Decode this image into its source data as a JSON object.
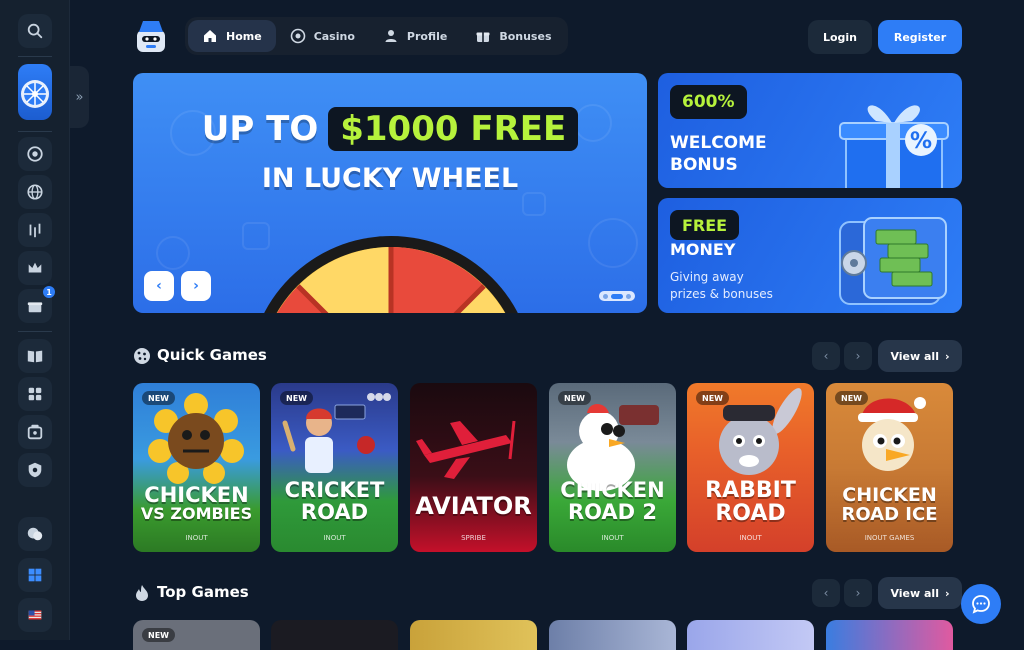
{
  "nav": {
    "items": [
      {
        "label": "Home",
        "icon": "home-icon",
        "active": true
      },
      {
        "label": "Casino",
        "icon": "casino-chip-icon",
        "active": false
      },
      {
        "label": "Profile",
        "icon": "user-icon",
        "active": false
      },
      {
        "label": "Bonuses",
        "icon": "gift-icon",
        "active": false
      }
    ]
  },
  "auth": {
    "login": "Login",
    "register": "Register"
  },
  "hero": {
    "line1_prefix": "UP TO",
    "line1_highlight": "$1000 FREE",
    "line2": "IN LUCKY WHEEL"
  },
  "promos": [
    {
      "tag": "600%",
      "title_1": "WELCOME",
      "title_2": "BONUS"
    },
    {
      "tag": "FREE",
      "title_1": "MONEY",
      "sub_1": "Giving away",
      "sub_2": "prizes & bonuses"
    }
  ],
  "sections": {
    "quick": {
      "title": "Quick Games",
      "view_all": "View all"
    },
    "top": {
      "title": "Top Games",
      "view_all": "View all"
    }
  },
  "quick_games": [
    {
      "badge": "NEW",
      "name_1": "CHICKEN",
      "name_2": "VS ZOMBIES",
      "provider": "INOUT"
    },
    {
      "badge": "NEW",
      "name_1": "CRICKET",
      "name_2": "ROAD",
      "provider": "INOUT"
    },
    {
      "badge": "",
      "name_1": "AVIATOR",
      "name_2": "",
      "provider": "SPRIBE"
    },
    {
      "badge": "NEW",
      "name_1": "CHICKEN",
      "name_2": "ROAD 2",
      "provider": "INOUT"
    },
    {
      "badge": "NEW",
      "name_1": "RABBIT",
      "name_2": "ROAD",
      "provider": "INOUT"
    },
    {
      "badge": "NEW",
      "name_1": "CHICKEN",
      "name_2": "ROAD ICE",
      "provider": "INOUT GAMES"
    }
  ],
  "top_games_first_badge": "NEW",
  "colors": {
    "accent": "#2e7df6",
    "highlight": "#b6f23c",
    "bg": "#0e1a2b"
  }
}
